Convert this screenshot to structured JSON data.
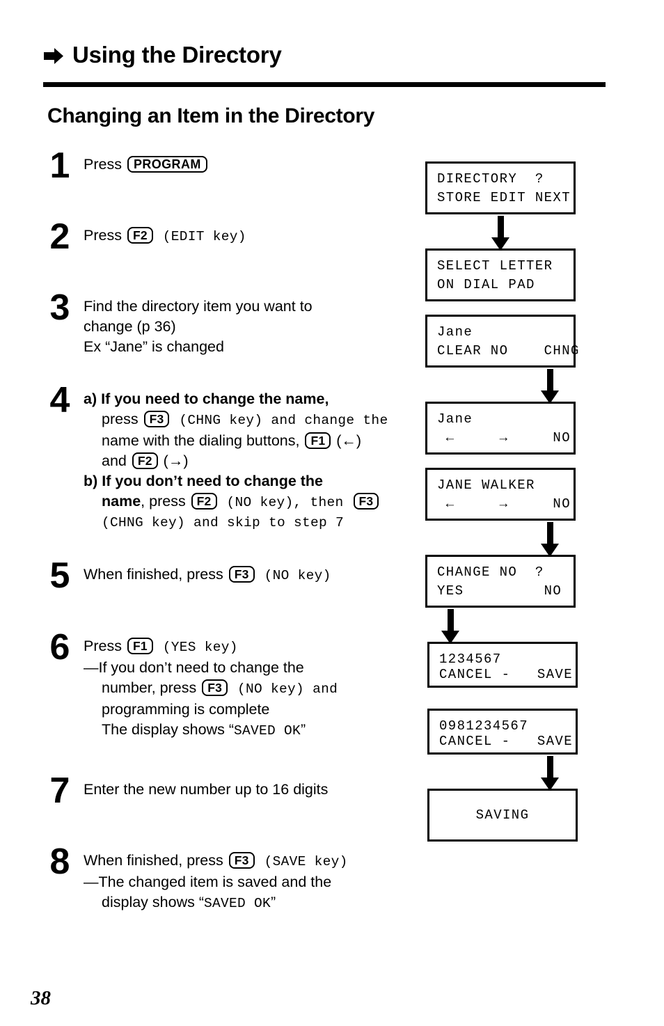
{
  "header": {
    "bullet_icon": "right-arrow-bullet-icon",
    "title": "Using the Directory",
    "subtitle": "Changing an Item in the Directory"
  },
  "steps": [
    {
      "number": "1",
      "lines": [
        {
          "text": "Press ",
          "key": "PROGRAM"
        }
      ]
    },
    {
      "number": "2",
      "lines": [
        {
          "text": "Press ",
          "key": "F2",
          "after": " (EDIT key)"
        }
      ]
    },
    {
      "number": "3",
      "lines": [
        {
          "text": "Find the directory item you want to"
        },
        {
          "text": "change (p 36)"
        },
        {
          "text": "Ex “Jane” is changed"
        }
      ]
    },
    {
      "number": "4",
      "a_label": "a)",
      "a_bold": "If you need to change the name,",
      "a_rest_1_pre": "press ",
      "a_rest_1_key": "F3",
      "a_rest_1_post": " (CHNG key) and change the",
      "a_rest_2_pre": "name with the dialing buttons, ",
      "a_rest_2_key": "F1",
      "a_rest_2_post": " (←)",
      "a_rest_3_pre": "and ",
      "a_rest_3_key": "F2",
      "a_rest_3_post": " (→)",
      "b_label": "b)",
      "b_bold_1": "If you don’t need to change the",
      "b_bold_2": "name",
      "b_rest_1": ", press ",
      "b_key_1": "F2",
      "b_rest_2": " (NO   key), then ",
      "b_key_2": "F3",
      "b_rest_3": "(CHNG key) and skip to step 7"
    },
    {
      "number": "5",
      "lines": [
        {
          "text": "When finished, press ",
          "key": "F3",
          "after": " (NO   key)"
        }
      ]
    },
    {
      "number": "6",
      "lines": [
        {
          "text": "Press ",
          "key": "F1",
          "after": " (YES key)"
        }
      ],
      "note": {
        "l1_pre": "—If you don’t need to change the",
        "l2_pre": "number, press ",
        "l2_key": "F3",
        "l2_post": " (NO key) and",
        "l3": "programming is complete",
        "l4_pre": "The display shows “",
        "l4_mono": "SAVED  OK",
        "l4_post": "”"
      }
    },
    {
      "number": "7",
      "lines": [
        {
          "text": "Enter the new number up to 16 digits"
        }
      ]
    },
    {
      "number": "8",
      "lines": [
        {
          "text": "When finished, press ",
          "key": "F3",
          "after": " (SAVE key)"
        }
      ],
      "note": {
        "l1_pre": "—The changed item is saved and the",
        "l2_pre": "display shows “",
        "l2_mono": "SAVED  OK",
        "l2_post": "”"
      }
    }
  ],
  "displays": [
    {
      "id": "display-directory-menu",
      "line1": "DIRECTORY  ?",
      "line2": "STORE EDIT NEXT",
      "center": false
    },
    {
      "id": "display-select-letter",
      "line1": "SELECT LETTER",
      "line2": "ON DIAL PAD",
      "center": false
    },
    {
      "id": "display-jane-clear",
      "line1": "Jane",
      "line2": "CLEAR NO    CHNG",
      "center": false
    },
    {
      "id": "display-jane-edit",
      "line1": "Jane",
      "line2": " ←     →     NO",
      "center": false
    },
    {
      "id": "display-jane-walker",
      "line1": "JANE WALKER",
      "line2": " ←     →     NO",
      "center": false
    },
    {
      "id": "display-change-no",
      "line1": "CHANGE NO  ?",
      "line2": "YES         NO",
      "center": false
    },
    {
      "id": "display-number-old",
      "line1": "1234567",
      "line2": "CANCEL -   SAVE",
      "center": false
    },
    {
      "id": "display-number-new",
      "line1": "0981234567",
      "line2": "CANCEL -   SAVE",
      "center": false
    },
    {
      "id": "display-saving",
      "line1": "SAVING",
      "line2": "",
      "center": true
    }
  ],
  "footer": {
    "page_number": "38"
  }
}
